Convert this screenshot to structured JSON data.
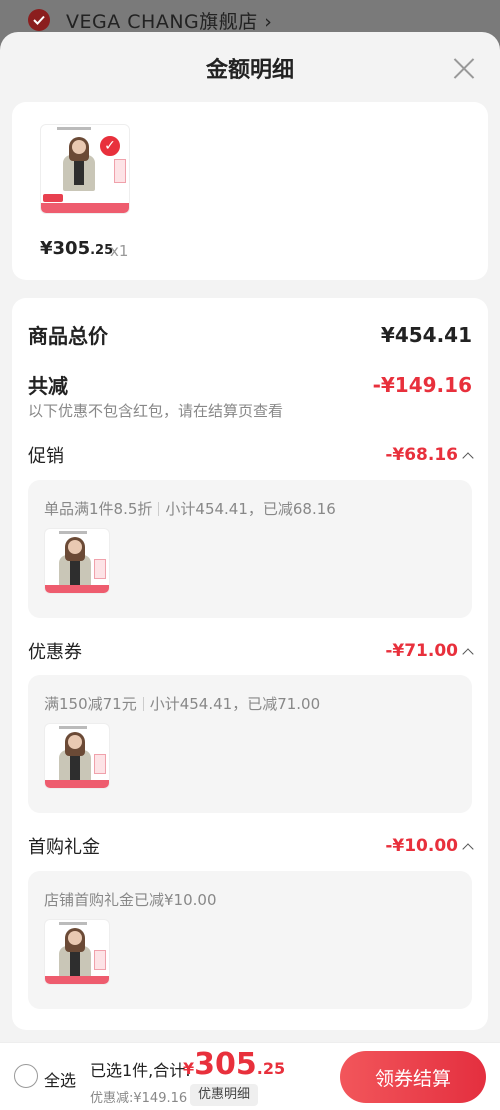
{
  "shop": {
    "name": "VEGA CHANG旗舰店 ›"
  },
  "sheet": {
    "title": "金额明细"
  },
  "product": {
    "price_main": "¥305",
    "price_dec": ".25",
    "qty": "x1"
  },
  "summary": {
    "goods_total_label": "商品总价",
    "goods_total_value": "¥454.41",
    "total_discount_label": "共减",
    "total_discount_value": "-¥149.16",
    "note": "以下优惠不包含红包，请在结算页查看",
    "sections": [
      {
        "label": "促销",
        "value": "-¥68.16",
        "detail_a": "单品满1件8.5折",
        "detail_b": "小计454.41，已减68.16"
      },
      {
        "label": "优惠券",
        "value": "-¥71.00",
        "detail_a": "满150减71元",
        "detail_b": "小计454.41，已减71.00"
      },
      {
        "label": "首购礼金",
        "value": "-¥10.00",
        "detail_a": "店铺首购礼金已减¥10.00",
        "detail_b": ""
      }
    ]
  },
  "bottom": {
    "select_all": "全选",
    "selected_info": "已选1件,合计:",
    "total_currency": "¥",
    "total_int": "305",
    "total_dec": ".25",
    "discount_line": "优惠减:¥149.16",
    "detail_chip": "优惠明细",
    "checkout": "领券结算"
  },
  "colors": {
    "accent": "#e8303c",
    "bg": "#f3f3f3"
  }
}
